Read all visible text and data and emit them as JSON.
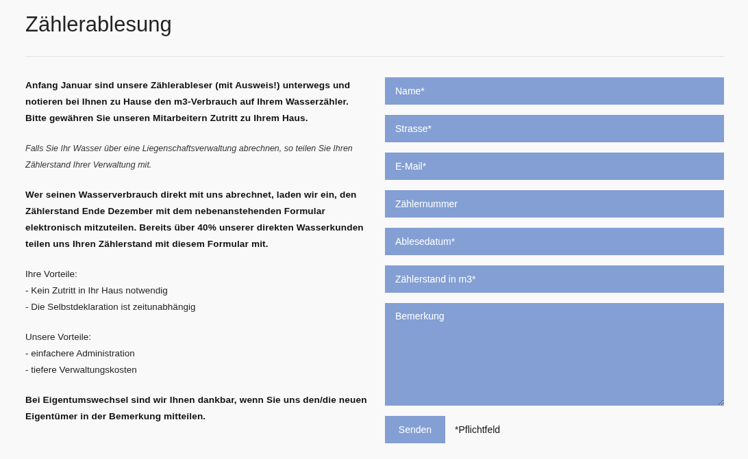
{
  "title": "Zählerablesung",
  "content": [
    {
      "kind": "bold",
      "text": "Anfang Januar sind unsere Zählerableser (mit Ausweis!) unterwegs und notieren bei Ihnen zu Hause den m3-Verbrauch auf Ihrem Wasserzähler. Bitte gewähren Sie unseren Mitarbeitern Zutritt zu Ihrem Haus."
    },
    {
      "kind": "italic",
      "text": "Falls Sie Ihr Wasser über eine Liegenschaftsverwaltung abrechnen, so teilen Sie Ihren Zählerstand Ihrer Verwaltung mit."
    },
    {
      "kind": "bold",
      "text": "Wer seinen Wasserverbrauch direkt mit uns abrechnet, laden wir ein, den Zählerstand Ende Dezember mit dem nebenanstehenden Formular elektronisch mitzuteilen. Bereits über 40% unserer direkten Wasserkunden teilen uns Ihren Zählerstand mit diesem Formular mit."
    },
    {
      "kind": "list",
      "heading": "Ihre Vorteile:",
      "items": [
        "- Kein Zutritt in Ihr Haus notwendig",
        "- Die Selbstdeklaration ist zeitunabhängig"
      ]
    },
    {
      "kind": "list",
      "heading": "Unsere Vorteile:",
      "items": [
        "- einfachere Administration",
        "- tiefere Verwaltungskosten"
      ]
    },
    {
      "kind": "bold",
      "text": "Bei Eigentumswechsel sind wir Ihnen dankbar, wenn Sie uns den/die neuen Eigentümer in der Bemerkung mitteilen."
    }
  ],
  "form": {
    "fields": [
      {
        "kind": "input",
        "placeholder": "Name*"
      },
      {
        "kind": "input",
        "placeholder": "Strasse*"
      },
      {
        "kind": "input",
        "placeholder": "E-Mail*"
      },
      {
        "kind": "input",
        "placeholder": "Zählernummer"
      },
      {
        "kind": "input",
        "placeholder": "Ablesedatum*"
      },
      {
        "kind": "input",
        "placeholder": "Zählerstand in m3*"
      },
      {
        "kind": "textarea",
        "placeholder": "Bemerkung"
      }
    ],
    "submit": "Senden",
    "required_note": "*Pflichtfeld"
  }
}
